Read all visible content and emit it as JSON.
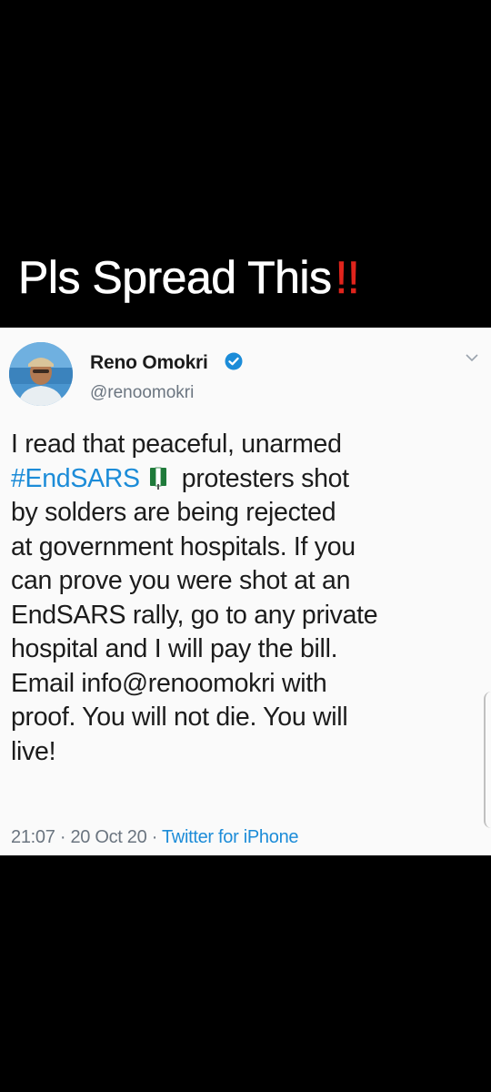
{
  "caption": {
    "text": "Pls Spread This",
    "emphasis": "!!"
  },
  "tweet": {
    "author_name": "Reno Omokri",
    "handle": "@renoomokri",
    "verified": true,
    "body": {
      "line1": "I read that peaceful, unarmed",
      "hashtag": "#EndSARS",
      "line2_rest": "protesters shot",
      "line3": "by solders are being rejected",
      "line4": "at government hospitals. If you",
      "line5": "can prove you were shot at an",
      "line6": "EndSARS rally, go to any private",
      "line7": "hospital and I will pay the bill.",
      "line8": "Email info@renoomokri with",
      "line9": "proof. You will not die. You will",
      "line10": "live!"
    },
    "time": "21:07",
    "date": "20 Oct 20",
    "source": "Twitter for iPhone",
    "separator": " · "
  },
  "colors": {
    "background": "#000000",
    "tweet_background": "#fafafa",
    "link_blue": "#1c8cd8",
    "emphasis_red": "#e0241c",
    "flag_green": "#1f7a3a"
  },
  "icons": {
    "verified": "verified-badge-icon",
    "menu": "chevron-down-icon",
    "hashtag_emoji": "nigeria-flag-icon"
  }
}
